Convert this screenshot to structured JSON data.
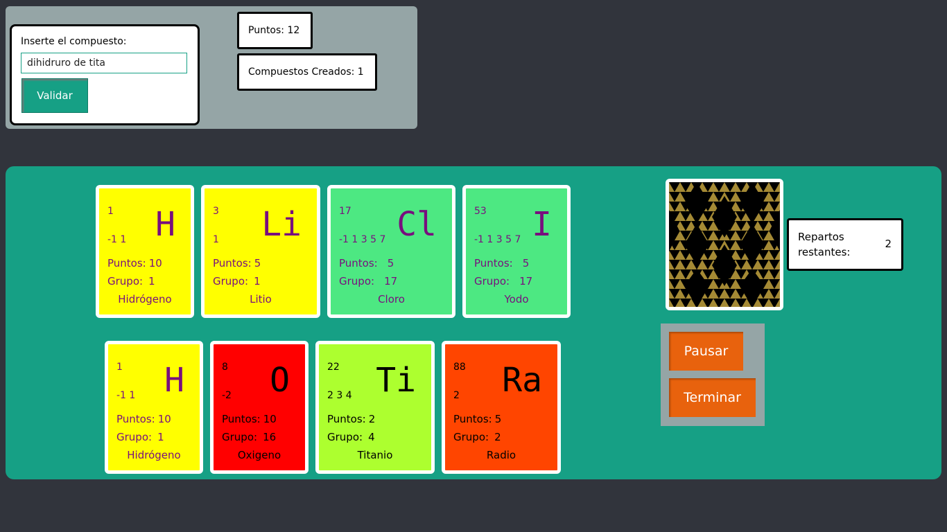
{
  "input_panel": {
    "label": "Inserte el compuesto:",
    "value": "dihidruro de tita",
    "validate_label": "Validar"
  },
  "stats": {
    "points": "Puntos: 12",
    "compounds": "Compuestos Creados: 1"
  },
  "labels": {
    "points_prefix": "Puntos:",
    "group_prefix": "Grupo:"
  },
  "cards_row1": [
    {
      "number": "1",
      "valences": "-1 1",
      "symbol": "H",
      "points": "10",
      "group": "1",
      "name": "Hidrógeno",
      "color": "#ffff00"
    },
    {
      "number": "3",
      "valences": "1",
      "symbol": "Li",
      "points": "5",
      "group": "1",
      "name": "Litio",
      "color": "#ffff00"
    },
    {
      "number": "17",
      "valences": "-1 1 3 5 7",
      "symbol": "Cl",
      "points": "5",
      "group": "17",
      "name": "Cloro",
      "color": "#4de882"
    },
    {
      "number": "53",
      "valences": "-1 1 3 5 7",
      "symbol": "I",
      "points": "5",
      "group": "17",
      "name": "Yodo",
      "color": "#4de882"
    }
  ],
  "cards_row2": [
    {
      "number": "1",
      "valences": "-1 1",
      "symbol": "H",
      "points": "10",
      "group": "1",
      "name": "Hidrógeno",
      "color": "#ffff00"
    },
    {
      "number": "8",
      "valences": "-2",
      "symbol": "O",
      "points": "10",
      "group": "16",
      "name": "Oxigeno",
      "color": "#ff0000"
    },
    {
      "number": "22",
      "valences": "2 3 4",
      "symbol": "Ti",
      "points": "2",
      "group": "4",
      "name": "Titanio",
      "color": "#adff2f"
    },
    {
      "number": "88",
      "valences": "2",
      "symbol": "Ra",
      "points": "5",
      "group": "2",
      "name": "Radio",
      "color": "#ff4500"
    }
  ],
  "deck": {
    "remaining_label": "Repartos restantes:",
    "remaining_count": "2"
  },
  "controls": {
    "pause_label": "Pausar",
    "finish_label": "Terminar"
  }
}
